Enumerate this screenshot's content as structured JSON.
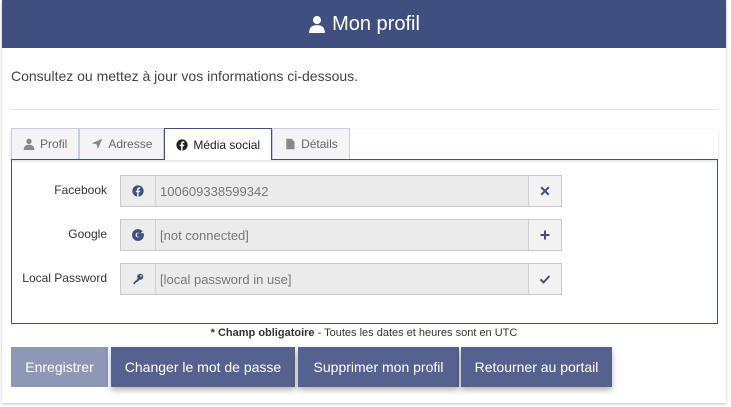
{
  "header": {
    "title": "Mon profil",
    "icon": "user-icon"
  },
  "intro": "Consultez ou mettez à jour vos informations ci-dessous.",
  "tabs": [
    {
      "label": "Profil",
      "icon": "user-icon",
      "active": false
    },
    {
      "label": "Adresse",
      "icon": "location-arrow-icon",
      "active": false
    },
    {
      "label": "Média social",
      "icon": "facebook-icon",
      "active": true
    },
    {
      "label": "Détails",
      "icon": "document-icon",
      "active": false
    }
  ],
  "social": {
    "facebook": {
      "label": "Facebook",
      "value": "100609338599342",
      "left_icon": "facebook-icon",
      "right_icon": "times-icon"
    },
    "google": {
      "label": "Google",
      "value": "[not connected]",
      "left_icon": "google-icon",
      "right_icon": "plus-icon"
    },
    "local": {
      "label": "Local Password",
      "value": "[local password in use]",
      "left_icon": "key-icon",
      "right_icon": "check-icon"
    }
  },
  "note": {
    "bold": "* Champ obligatoire",
    "rest": " - Toutes les dates et heures sont en UTC"
  },
  "buttons": {
    "save": "Enregistrer",
    "change_password": "Changer le mot de passe",
    "delete_profile": "Supprimer mon profil",
    "back_portal": "Retourner au portail"
  },
  "colors": {
    "primary": "#3f4f7f",
    "button": "#55618f",
    "button_disabled": "#8e97b5"
  }
}
